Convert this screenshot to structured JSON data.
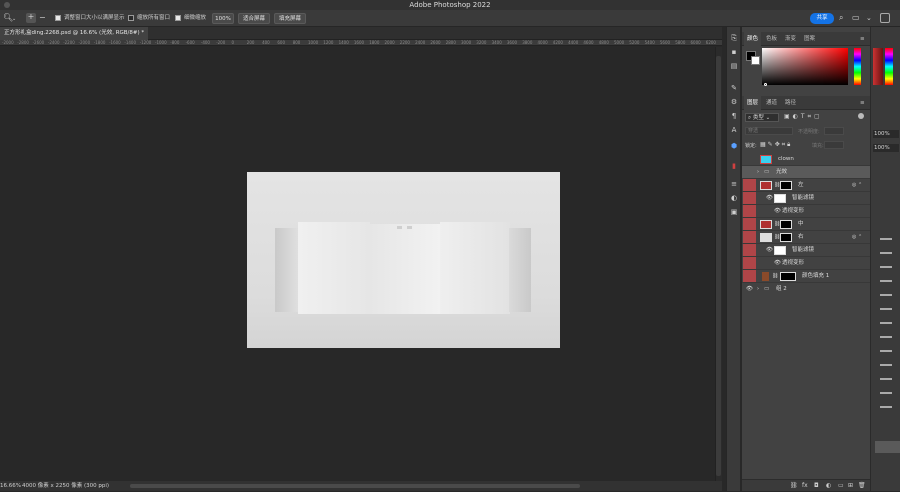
{
  "app": {
    "title": "Adobe Photoshop 2022"
  },
  "options": {
    "resize_windows": "调整窗口大小以满屏显示",
    "zoom_all_windows": "缩放所有窗口",
    "scrubby_zoom": "细微缩放",
    "zoom_value": "100%",
    "fit_screen": "适合屏幕",
    "fill_screen": "填充屏幕",
    "share": "共享"
  },
  "document": {
    "tab_title": "正方形礼盒ding.2268.psd @ 16.6% (光效, RGB/8#) *"
  },
  "ruler": {
    "ticks": [
      "-2000",
      "-2800",
      "-2600",
      "-2400",
      "-2200",
      "-2000",
      "-1800",
      "-1600",
      "-1400",
      "-1200",
      "-1000",
      "-800",
      "-600",
      "-400",
      "-200",
      "0",
      "200",
      "400",
      "600",
      "800",
      "1000",
      "1200",
      "1400",
      "1600",
      "1800",
      "2000",
      "2200",
      "2400",
      "2600",
      "2800",
      "3000",
      "3200",
      "3400",
      "3600",
      "3800",
      "4000",
      "4200",
      "4400",
      "4600",
      "4800",
      "5000",
      "5200",
      "5400",
      "5600",
      "5800",
      "6000",
      "6200"
    ]
  },
  "status": {
    "zoom": "16.66%",
    "doc_size": "4000 像素 x 2250 像素 (300 ppi)"
  },
  "color_panel": {
    "tabs": [
      "颜色",
      "色板",
      "渐变",
      "图案"
    ]
  },
  "layers_panel": {
    "tabs": [
      "图层",
      "通道",
      "路径"
    ],
    "filter_kind": "类型",
    "blend_mode": "穿透",
    "opacity_label": "不透明度:",
    "lock_label": "锁定:",
    "fill_label": "填充:",
    "layers": [
      {
        "name": "clown",
        "type": "pixel"
      },
      {
        "name": "光效",
        "type": "group"
      },
      {
        "name": "左",
        "type": "smart"
      },
      {
        "name": "智能滤镜",
        "type": "filter"
      },
      {
        "name": "透视变形",
        "type": "effect"
      },
      {
        "name": "中",
        "type": "smart"
      },
      {
        "name": "右",
        "type": "smart"
      },
      {
        "name": "智能滤镜",
        "type": "filter"
      },
      {
        "name": "透视变形",
        "type": "effect"
      },
      {
        "name": "颜色填充 1",
        "type": "fill"
      },
      {
        "name": "组 2",
        "type": "group"
      }
    ]
  },
  "right_edge": {
    "pct1": "100%",
    "pct2": "100%"
  },
  "colors": {
    "accent": "#1473e6",
    "layer_tag_red": "#b04548",
    "clown_thumb": "#3ad0f0"
  }
}
